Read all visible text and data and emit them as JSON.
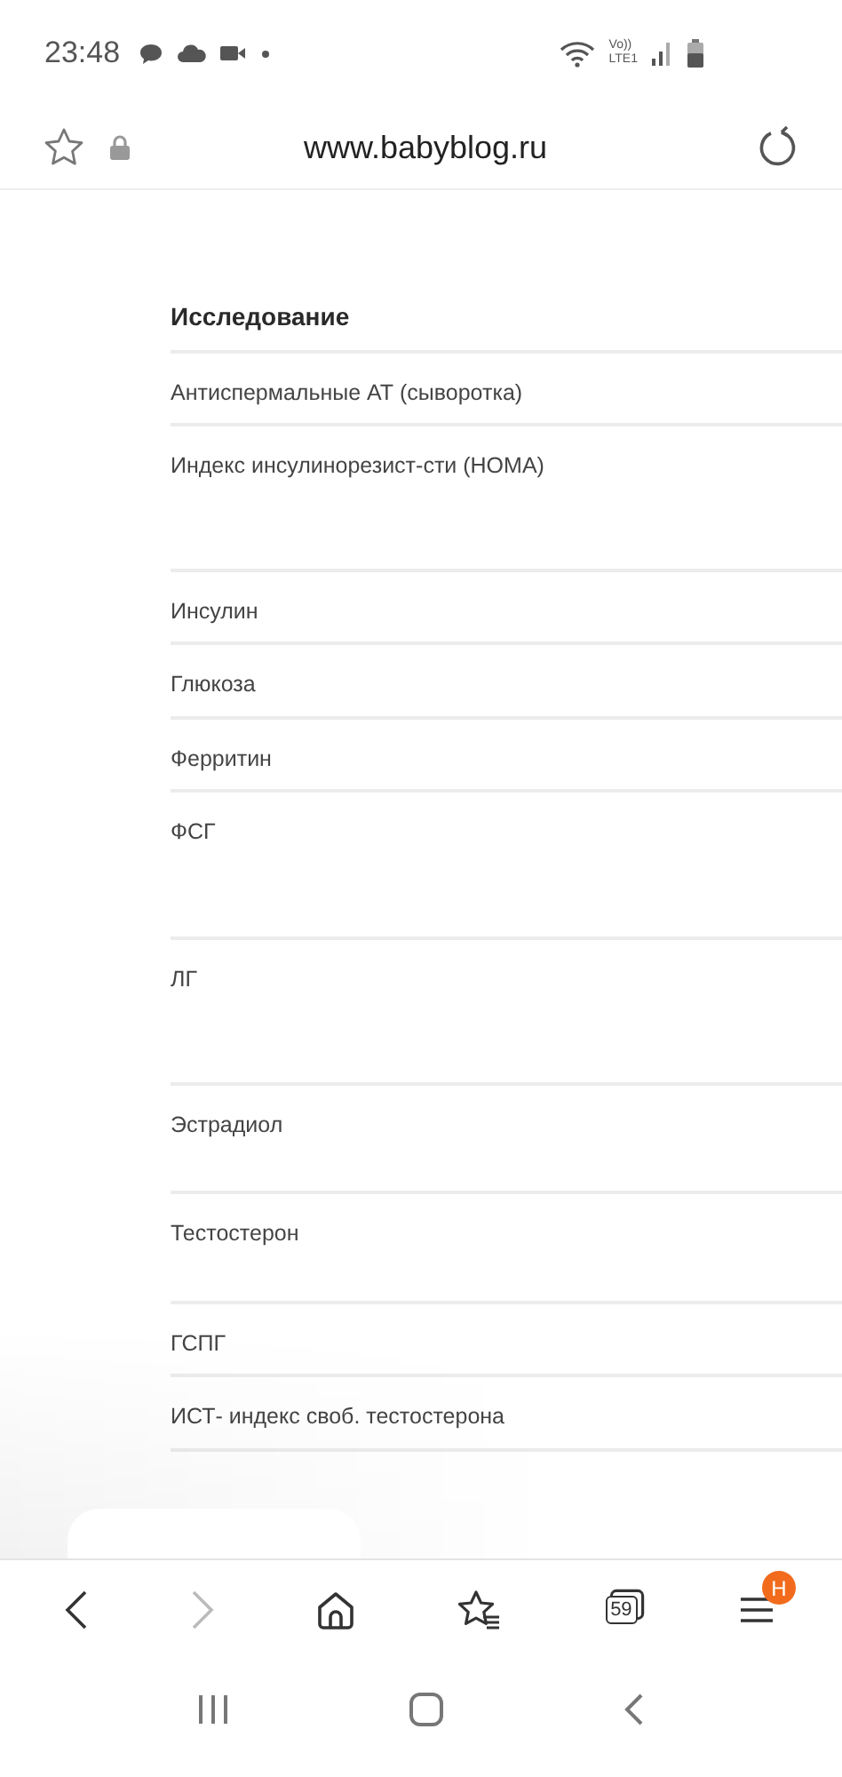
{
  "status_bar": {
    "time": "23:48",
    "network_labels": [
      "Vo))",
      "LTE1"
    ]
  },
  "address_bar": {
    "url": "www.babyblog.ru",
    "bookmarked": false,
    "secure": true
  },
  "table": {
    "columns": [
      "Исследование"
    ],
    "rows": [
      {
        "label": "Антиспермальные АТ (сыворотка)"
      },
      {
        "label": "Индекс инсулинорезист-сти (HOMA)"
      },
      {
        "label": "Инсулин"
      },
      {
        "label": "Глюкоза"
      },
      {
        "label": "Ферритин"
      },
      {
        "label": "ФСГ"
      },
      {
        "label": "ЛГ"
      },
      {
        "label": "Эстрадиол"
      },
      {
        "label": "Тестостерон"
      },
      {
        "label": "ГСПГ"
      },
      {
        "label": "ИСТ- индекс своб. тестостерона"
      }
    ]
  },
  "toolbar": {
    "back_disabled": false,
    "forward_disabled": true,
    "tab_count": "59",
    "menu_badge": "H"
  }
}
